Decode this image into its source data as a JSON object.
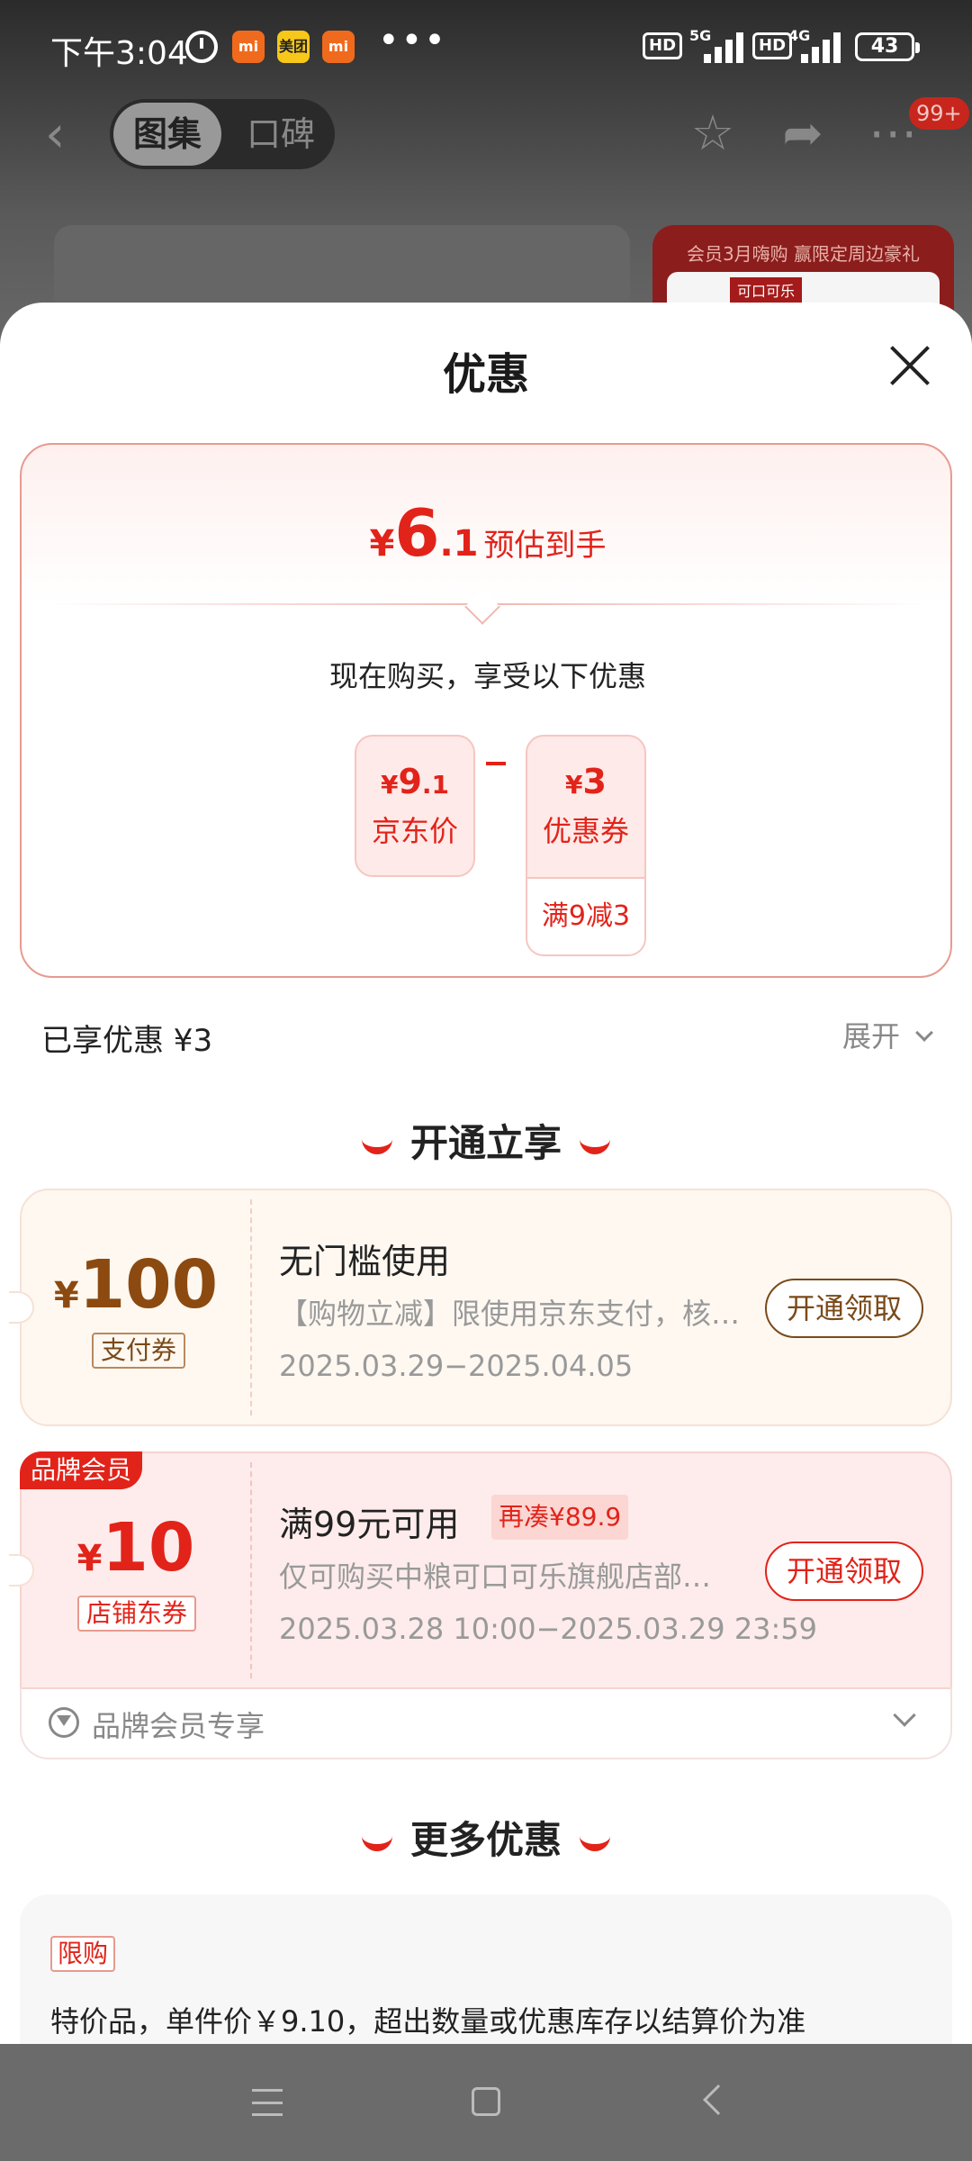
{
  "status_bar": {
    "time": "下午3:04",
    "app_icons": [
      "mi",
      "美团",
      "mi"
    ],
    "more": "•••",
    "hd1": "HD",
    "net1": "5G",
    "hd2": "HD",
    "net2": "4G",
    "battery": "43"
  },
  "background_page": {
    "tabs": [
      "图集",
      "口碑"
    ],
    "badge": "99+",
    "promo_text": "会员3月嗨购 赢限定周边豪礼",
    "promo_tag": "可口可乐"
  },
  "sheet": {
    "title": "优惠",
    "estimate": {
      "currency": "¥",
      "int": "6",
      "dec": ".1",
      "label": "预估到手"
    },
    "buy_now": "现在购买，享受以下优惠",
    "jd_price": {
      "currency": "¥",
      "int": "9",
      "dec": ".1",
      "label": "京东价"
    },
    "minus": "−",
    "coupon_off": {
      "currency": "¥",
      "value": "3",
      "label": "优惠券",
      "sub": "满9减3"
    },
    "enjoyed": "已享优惠 ¥3",
    "expand": "展开"
  },
  "section_open": {
    "title": "开通立享",
    "coupons": [
      {
        "currency": "¥",
        "amount": "100",
        "tag": "支付券",
        "title": "无门槛使用",
        "desc": "【购物立减】限使用京东支付，核…",
        "date": "2025.03.29−2025.04.05",
        "button": "开通领取"
      },
      {
        "badge": "品牌会员",
        "currency": "¥",
        "amount": "10",
        "tag": "店铺东券",
        "title": "满99元可用",
        "extra_tag": "再凑¥89.9",
        "desc": "仅可购买中粮可口可乐旗舰店部…",
        "date": "2025.03.28 10:00−2025.03.29 23:59",
        "button": "开通领取"
      }
    ],
    "member_exclusive": "品牌会员专享"
  },
  "section_more": {
    "title": "更多优惠",
    "limit_tag": "限购",
    "text": "特价品，单件价￥9.10，超出数量或优惠库存以结算价为准"
  },
  "colors": {
    "accent": "#e2231a",
    "gold": "#7a4a1a"
  }
}
